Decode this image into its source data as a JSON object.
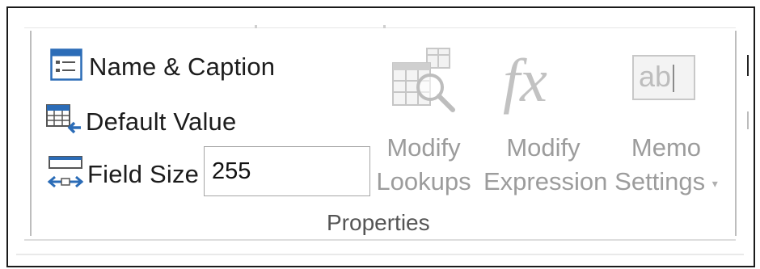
{
  "properties_group": {
    "label": "Properties",
    "name_caption": {
      "label": "Name & Caption",
      "icon": "name-caption-icon"
    },
    "default_value": {
      "label": "Default Value",
      "icon": "default-value-icon"
    },
    "field_size": {
      "label": "Field Size",
      "value": "255",
      "icon": "field-size-icon"
    },
    "modify_lookups": {
      "line1": "Modify",
      "line2": "Lookups",
      "icon": "lookup-table-icon",
      "enabled": false
    },
    "modify_expression": {
      "line1": "Modify",
      "line2": "Expression",
      "icon": "fx-icon",
      "enabled": false
    },
    "memo_settings": {
      "line1": "Memo",
      "line2": "Settings",
      "icon": "ab-textbox-icon",
      "enabled": false,
      "has_dropdown": true
    }
  },
  "colors": {
    "accent": "#2b6cb7",
    "disabled_text": "#9c9c9c",
    "icon_gray": "#c8c8c8"
  }
}
